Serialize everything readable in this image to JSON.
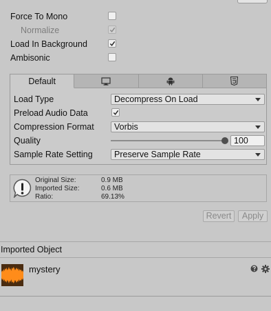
{
  "settings": {
    "force_to_mono": {
      "label": "Force To Mono",
      "checked": false
    },
    "normalize": {
      "label": "Normalize",
      "checked": true
    },
    "load_in_background": {
      "label": "Load In Background",
      "checked": true
    },
    "ambisonic": {
      "label": "Ambisonic",
      "checked": false
    }
  },
  "platform_tabs": [
    {
      "label": "Default",
      "icon": "",
      "active": true
    },
    {
      "label": "",
      "icon": "monitor-icon",
      "active": false
    },
    {
      "label": "",
      "icon": "android-icon",
      "active": false
    },
    {
      "label": "",
      "icon": "html5-icon",
      "active": false
    }
  ],
  "properties": {
    "load_type": {
      "label": "Load Type",
      "value": "Decompress On Load"
    },
    "preload_audio_data": {
      "label": "Preload Audio Data",
      "checked": true
    },
    "compression_format": {
      "label": "Compression Format",
      "value": "Vorbis"
    },
    "quality": {
      "label": "Quality",
      "value": "100",
      "fraction": 1.0
    },
    "sample_rate_setting": {
      "label": "Sample Rate Setting",
      "value": "Preserve Sample Rate"
    }
  },
  "info": {
    "original_size": {
      "label": "Original Size:",
      "value": "0.9 MB"
    },
    "imported_size": {
      "label": "Imported Size:",
      "value": "0.6 MB"
    },
    "ratio": {
      "label": "Ratio:",
      "value": "69.13%"
    }
  },
  "buttons": {
    "revert": "Revert",
    "apply": "Apply"
  },
  "imported_object": {
    "header": "Imported Object",
    "name": "mystery",
    "icons": [
      "help-icon",
      "gear-icon"
    ]
  },
  "colors": {
    "waveform": "#ff8c1a",
    "panel": "#c8c8c8"
  }
}
